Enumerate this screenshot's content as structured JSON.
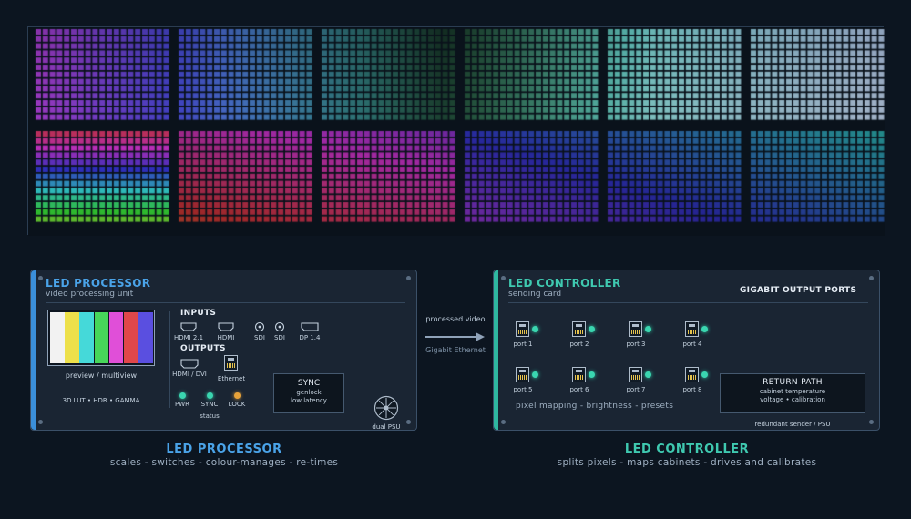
{
  "processor": {
    "title": "LED PROCESSOR",
    "subtitle": "video processing unit",
    "preview_label": "preview / multiview",
    "features": "3D LUT  •  HDR  •  GAMMA",
    "inputs_heading": "INPUTS",
    "inputs": [
      "HDMI 2.1",
      "HDMI",
      "SDI",
      "SDI",
      "DP 1.4"
    ],
    "outputs_heading": "OUTPUTS",
    "outputs": [
      "HDMI / DVI",
      "Ethernet"
    ],
    "status_leds": [
      {
        "label": "PWR",
        "color": "#3ad6b0"
      },
      {
        "label": "SYNC",
        "color": "#3ad6b0"
      },
      {
        "label": "LOCK",
        "color": "#e8a33a"
      }
    ],
    "status_label": "status",
    "sync": {
      "title": "SYNC",
      "lines": [
        "genlock",
        "low latency"
      ]
    },
    "psu_label": "dual PSU",
    "color_bars": [
      "#f2f2f2",
      "#ede04a",
      "#45d9d9",
      "#47d65a",
      "#e04fd8",
      "#e0474a",
      "#5a4fe0"
    ],
    "accent": "#3b8fd9"
  },
  "link": {
    "top": "processed video",
    "bottom": "Gigabit Ethernet"
  },
  "controller": {
    "title": "LED CONTROLLER",
    "subtitle": "sending card",
    "ports_heading": "GIGABIT OUTPUT PORTS",
    "ports": [
      "port 1",
      "port 2",
      "port 3",
      "port 4",
      "port 5",
      "port 6",
      "port 7",
      "port 8"
    ],
    "features": "pixel mapping  -  brightness  -  presets",
    "return_path": {
      "title": "RETURN PATH",
      "lines": [
        "cabinet temperature",
        "voltage  •  calibration"
      ]
    },
    "footer": "redundant sender / PSU",
    "accent": "#2fb8a0"
  },
  "captions": {
    "processor_title": "LED PROCESSOR",
    "processor_sub": "scales  -  switches  -  colour-manages  -  re-times",
    "controller_title": "LED CONTROLLER",
    "controller_sub": "splits pixels  -  maps cabinets  -  drives and calibrates"
  },
  "colors": {
    "processor_text": "#4aa3e8",
    "controller_text": "#3fc9b0"
  }
}
